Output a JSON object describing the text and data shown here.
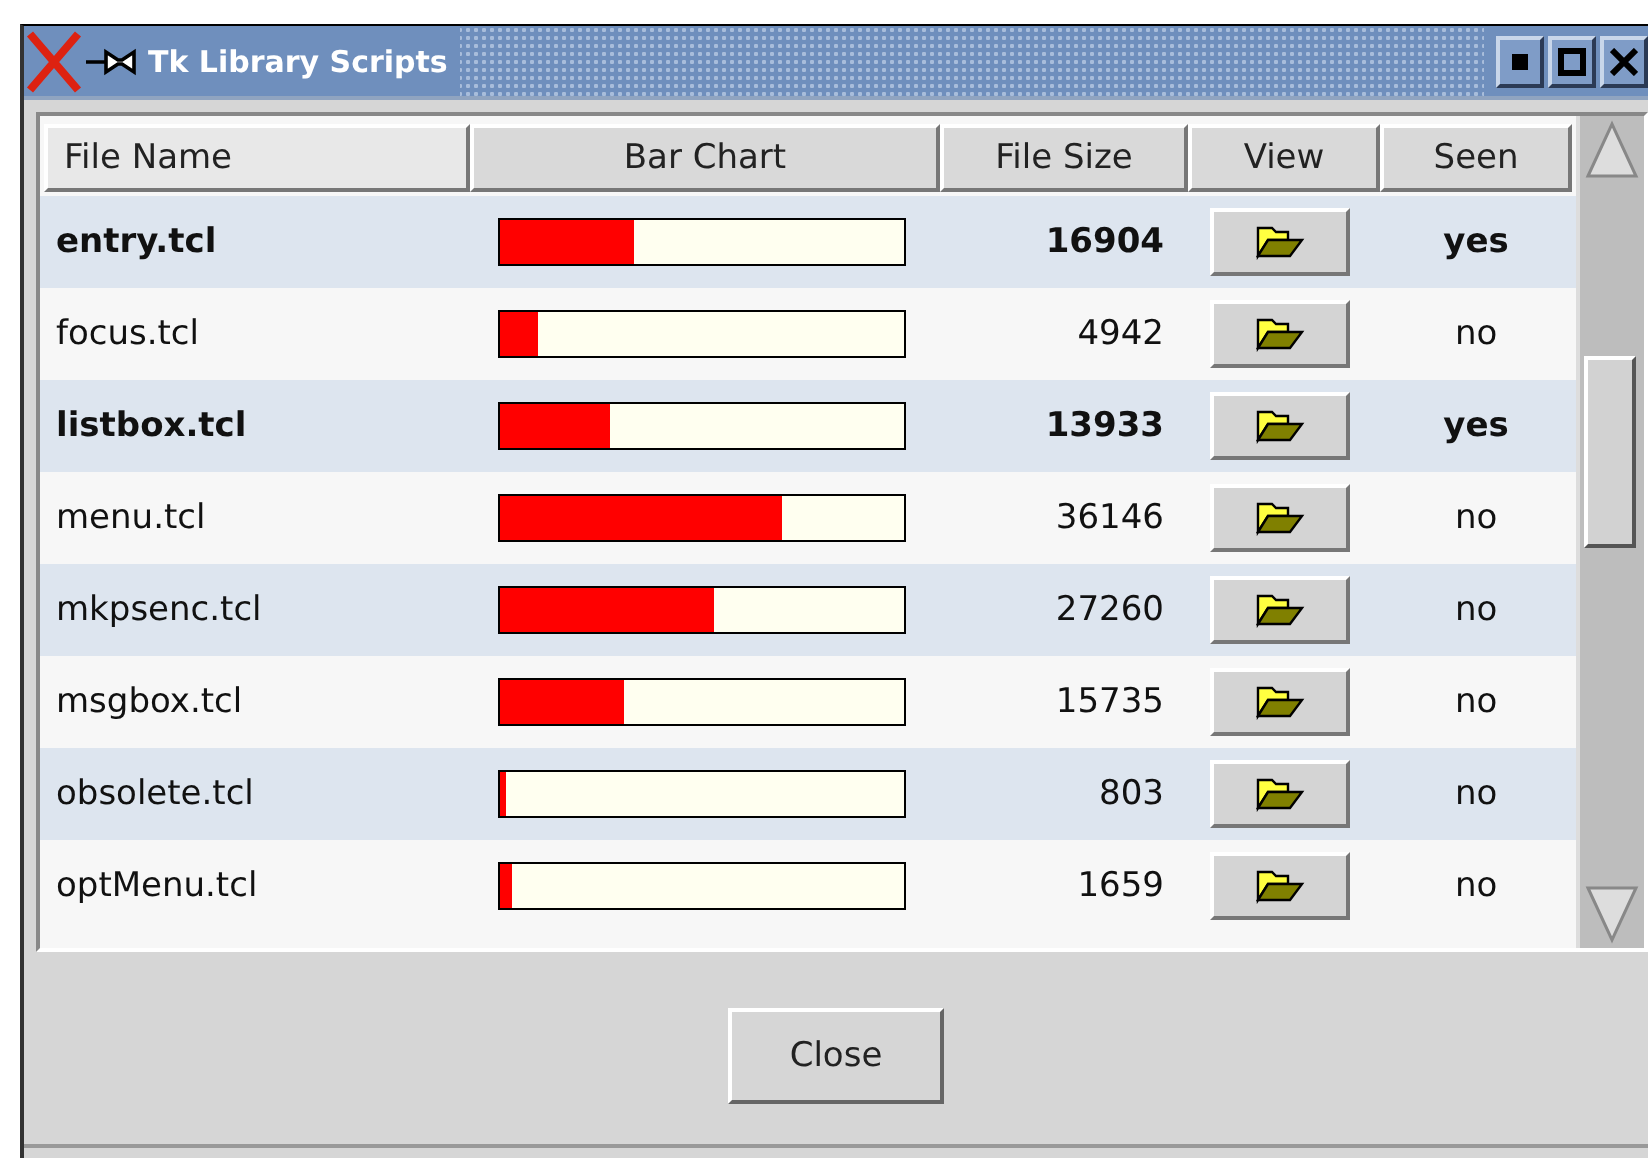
{
  "window": {
    "title": "Tk Library Scripts"
  },
  "table": {
    "columns": [
      "File Name",
      "Bar Chart",
      "File Size",
      "View",
      "Seen"
    ],
    "rows": [
      {
        "name": "entry.tcl",
        "level": 0.33,
        "size": "16904",
        "seen": "yes",
        "highlighted": true
      },
      {
        "name": "focus.tcl",
        "level": 0.093,
        "size": "4942",
        "seen": "no",
        "highlighted": false
      },
      {
        "name": "listbox.tcl",
        "level": 0.27,
        "size": "13933",
        "seen": "yes",
        "highlighted": true
      },
      {
        "name": "menu.tcl",
        "level": 0.7,
        "size": "36146",
        "seen": "no",
        "highlighted": false
      },
      {
        "name": "mkpsenc.tcl",
        "level": 0.53,
        "size": "27260",
        "seen": "no",
        "highlighted": false
      },
      {
        "name": "msgbox.tcl",
        "level": 0.305,
        "size": "15735",
        "seen": "no",
        "highlighted": false
      },
      {
        "name": "obsolete.tcl",
        "level": 0.016,
        "size": "803",
        "seen": "no",
        "highlighted": false
      },
      {
        "name": "optMenu.tcl",
        "level": 0.032,
        "size": "1659",
        "seen": "no",
        "highlighted": false
      }
    ]
  },
  "buttons": [
    {
      "label": "Close"
    }
  ]
}
